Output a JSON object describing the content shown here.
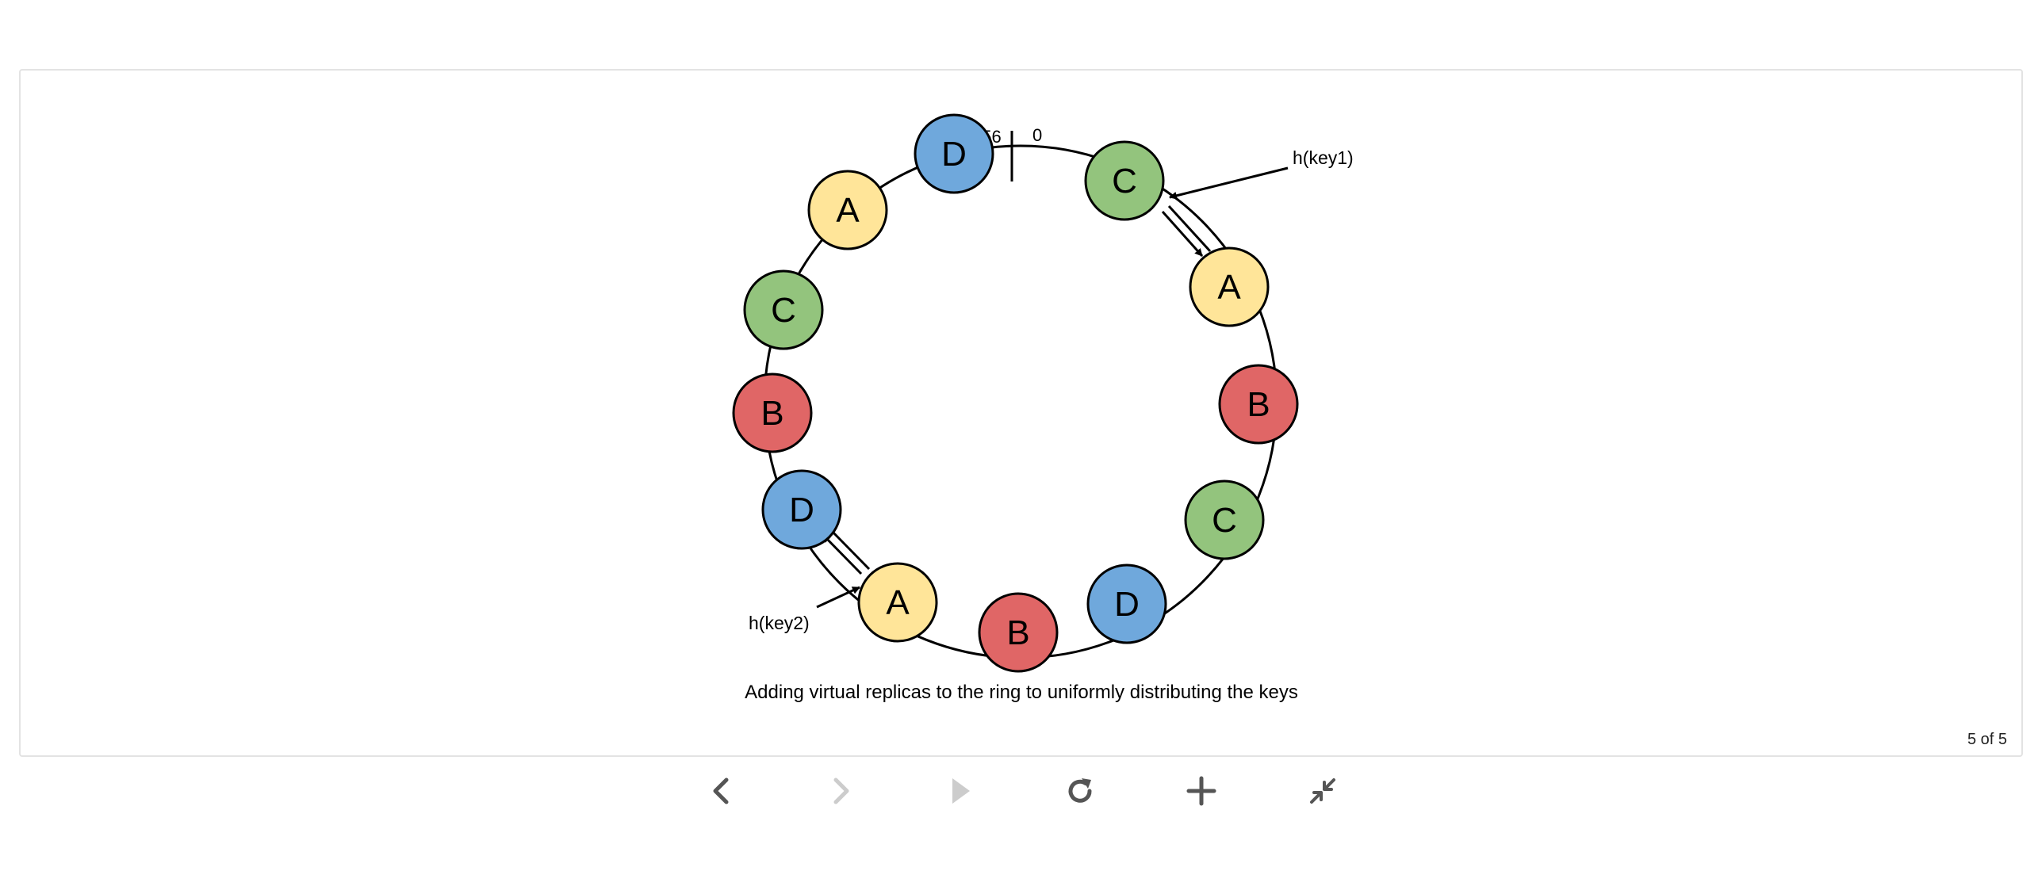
{
  "figure": {
    "caption": "Adding virtual replicas to the ring to uniformly distributing the keys",
    "ring_labels": {
      "max": "256",
      "min": "0"
    },
    "keys": [
      {
        "label": "h(key1)"
      },
      {
        "label": "h(key2)"
      }
    ],
    "nodes": [
      {
        "label": "D",
        "color": "#6fa8dc"
      },
      {
        "label": "C",
        "color": "#93c47d"
      },
      {
        "label": "A",
        "color": "#ffe599"
      },
      {
        "label": "B",
        "color": "#e06666"
      },
      {
        "label": "C",
        "color": "#93c47d"
      },
      {
        "label": "D",
        "color": "#6fa8dc"
      },
      {
        "label": "B",
        "color": "#e06666"
      },
      {
        "label": "A",
        "color": "#ffe599"
      },
      {
        "label": "D",
        "color": "#6fa8dc"
      },
      {
        "label": "B",
        "color": "#e06666"
      },
      {
        "label": "C",
        "color": "#93c47d"
      },
      {
        "label": "A",
        "color": "#ffe599"
      }
    ]
  },
  "viewer": {
    "counter": "5 of 5",
    "controls": [
      {
        "name": "previous-icon",
        "enabled": true
      },
      {
        "name": "next-icon",
        "enabled": false
      },
      {
        "name": "play-icon",
        "enabled": false
      },
      {
        "name": "reload-icon",
        "enabled": true
      },
      {
        "name": "zoom-in-icon",
        "enabled": true
      },
      {
        "name": "collapse-icon",
        "enabled": true
      }
    ]
  },
  "colors": {
    "blue": "#6fa8dc",
    "green": "#93c47d",
    "yellow": "#ffe599",
    "red": "#e06666",
    "control_active": "#555555",
    "control_disabled": "#cccccc"
  }
}
